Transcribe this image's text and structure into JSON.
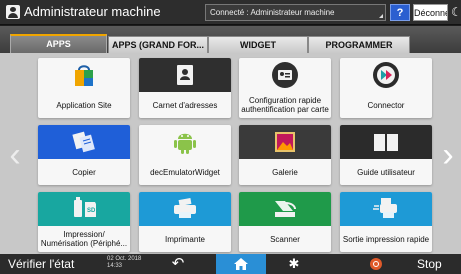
{
  "header": {
    "title": "Administrateur machine",
    "connection": "Connecté : Administrateur machine",
    "help_label": "?",
    "logout_label": "Déconnexion",
    "night_mode_glyph": "☾"
  },
  "tabs": [
    {
      "label": "APPS",
      "active": true
    },
    {
      "label": "APPS (GRAND FOR...",
      "active": false
    },
    {
      "label": "WIDGET",
      "active": false
    },
    {
      "label": "PROGRAMMER",
      "active": false
    }
  ],
  "apps": [
    {
      "label": "Application Site",
      "icon": "shopping-bag-icon",
      "bg": "#f4f4f4"
    },
    {
      "label": "Carnet d'adresses",
      "icon": "address-book-icon",
      "bg": "#2f2f2f"
    },
    {
      "label": "Configuration rapide authentification par carte",
      "icon": "id-card-icon",
      "bg": "#f4f4f4"
    },
    {
      "label": "Connector",
      "icon": "connector-icon",
      "bg": "#f4f4f4"
    },
    {
      "label": "Copier",
      "icon": "copier-icon",
      "bg": "#1f5fd8"
    },
    {
      "label": "decEmulatorWidget",
      "icon": "android-icon",
      "bg": "#f4f4f4"
    },
    {
      "label": "Galerie",
      "icon": "gallery-icon",
      "bg": "#3a3a3a"
    },
    {
      "label": "Guide utilisateur",
      "icon": "book-icon",
      "bg": "#2b2b2b"
    },
    {
      "label": "Impression/ Numérisation (Périphé...",
      "icon": "usb-sd-icon",
      "bg": "#18a7a0"
    },
    {
      "label": "Imprimante",
      "icon": "printer-icon",
      "bg": "#1e9ad6"
    },
    {
      "label": "Scanner",
      "icon": "scanner-icon",
      "bg": "#1f9a4a"
    },
    {
      "label": "Sortie impression rapide",
      "icon": "quick-print-icon",
      "bg": "#1e9ad6"
    }
  ],
  "nav": {
    "prev_glyph": "‹",
    "next_glyph": "›"
  },
  "footer": {
    "status_label": "Vérifier l'état",
    "date": "02 Oct. 2018",
    "time": "14:33",
    "back_glyph": "↶",
    "settings_glyph": "✱",
    "stop_label": "Stop"
  },
  "colors": {
    "home_accent": "#2a8fd6",
    "active_tab_underline": "#f0a500",
    "help_button": "#2b5fd0",
    "stop_button": "#e05a2a"
  }
}
